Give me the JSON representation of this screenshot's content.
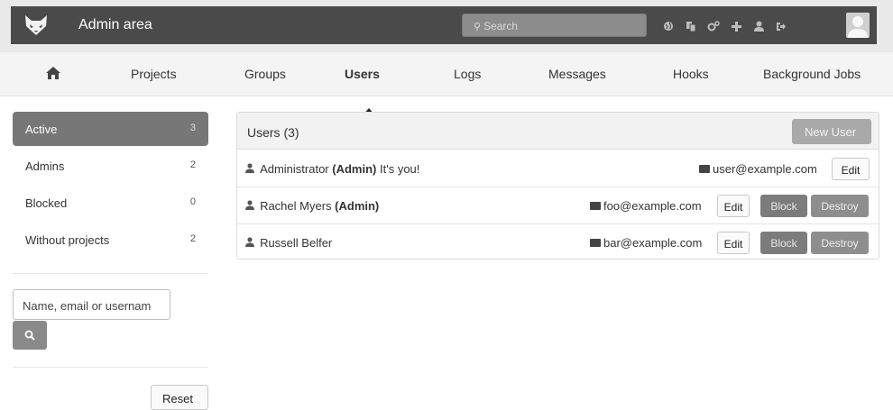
{
  "header": {
    "title": "Admin area",
    "search_placeholder": "Search",
    "icons": [
      "globe-icon",
      "copy-icon",
      "cogs-icon",
      "plus-icon",
      "user-icon",
      "sign-out-icon"
    ],
    "avatar": "avatar"
  },
  "nav": {
    "home_icon": "home-icon",
    "items": [
      {
        "label": "Projects"
      },
      {
        "label": "Groups"
      },
      {
        "label": "Users",
        "active": true
      },
      {
        "label": "Logs"
      },
      {
        "label": "Messages"
      },
      {
        "label": "Hooks"
      },
      {
        "label": "Background Jobs"
      }
    ]
  },
  "sidebar": {
    "items": [
      {
        "label": "Active",
        "count": "3",
        "active": true
      },
      {
        "label": "Admins",
        "count": "2"
      },
      {
        "label": "Blocked",
        "count": "0"
      },
      {
        "label": "Without projects",
        "count": "2"
      }
    ],
    "filter_value": "Name, email or usernam",
    "reset_label": "Reset"
  },
  "users_panel": {
    "title": "Users (3)",
    "new_user_label": "New User",
    "rows": [
      {
        "name": "Administrator",
        "admin_tag": "(Admin)",
        "note": "It's you!",
        "email": "user@example.com",
        "edit": "Edit"
      },
      {
        "name": "Rachel Myers",
        "admin_tag": "(Admin)",
        "note": "",
        "email": "foo@example.com",
        "edit": "Edit",
        "block": "Block",
        "destroy": "Destroy"
      },
      {
        "name": "Russell Belfer",
        "admin_tag": "",
        "note": "",
        "email": "bar@example.com",
        "edit": "Edit",
        "block": "Block",
        "destroy": "Destroy"
      }
    ]
  },
  "colors": {
    "topbar": "#4a4a4a",
    "active_sidebar": "#777777",
    "block_button": "#7c7c7c",
    "destroy_button": "#8e8e8e"
  }
}
